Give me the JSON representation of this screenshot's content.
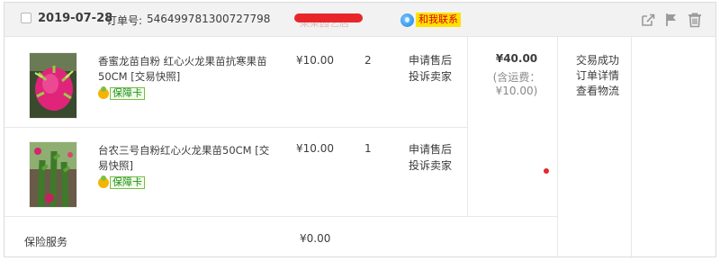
{
  "order": {
    "date": "2019-07-28",
    "order_no_label": "订单号:",
    "order_no": "546499781300727798",
    "shop_name": "某某园艺店",
    "contact_label": "和我联系"
  },
  "items": [
    {
      "title": "香蜜龙苗自粉 红心火龙果苗抗寒果苗50CM [交易快照]",
      "badge": "保障卡",
      "price": "¥10.00",
      "qty": "2",
      "op1": "申请售后",
      "op2": "投诉卖家",
      "image": "red-dragon-fruit-photo"
    },
    {
      "title": "台农三号自粉红心火龙果苗50CM [交易快照]",
      "badge": "保障卡",
      "price": "¥10.00",
      "qty": "1",
      "op1": "申请售后",
      "op2": "投诉卖家",
      "image": "dragon-fruit-plant-photo"
    }
  ],
  "summary": {
    "total": "¥40.00",
    "shipping": "(含运费：¥10.00)"
  },
  "status": {
    "state": "交易成功",
    "detail": "订单详情",
    "logistics": "查看物流"
  },
  "insurance": {
    "label": "保险服务",
    "price": "¥0.00"
  },
  "icons": [
    "checkbox-icon",
    "wangwang-icon",
    "share-icon",
    "flag-icon",
    "trash-icon"
  ],
  "colors": {
    "header_bg": "#f2f2f2",
    "border": "#dcdcdc",
    "redact": "#e8262a",
    "contact_bg": "#ffe100"
  }
}
